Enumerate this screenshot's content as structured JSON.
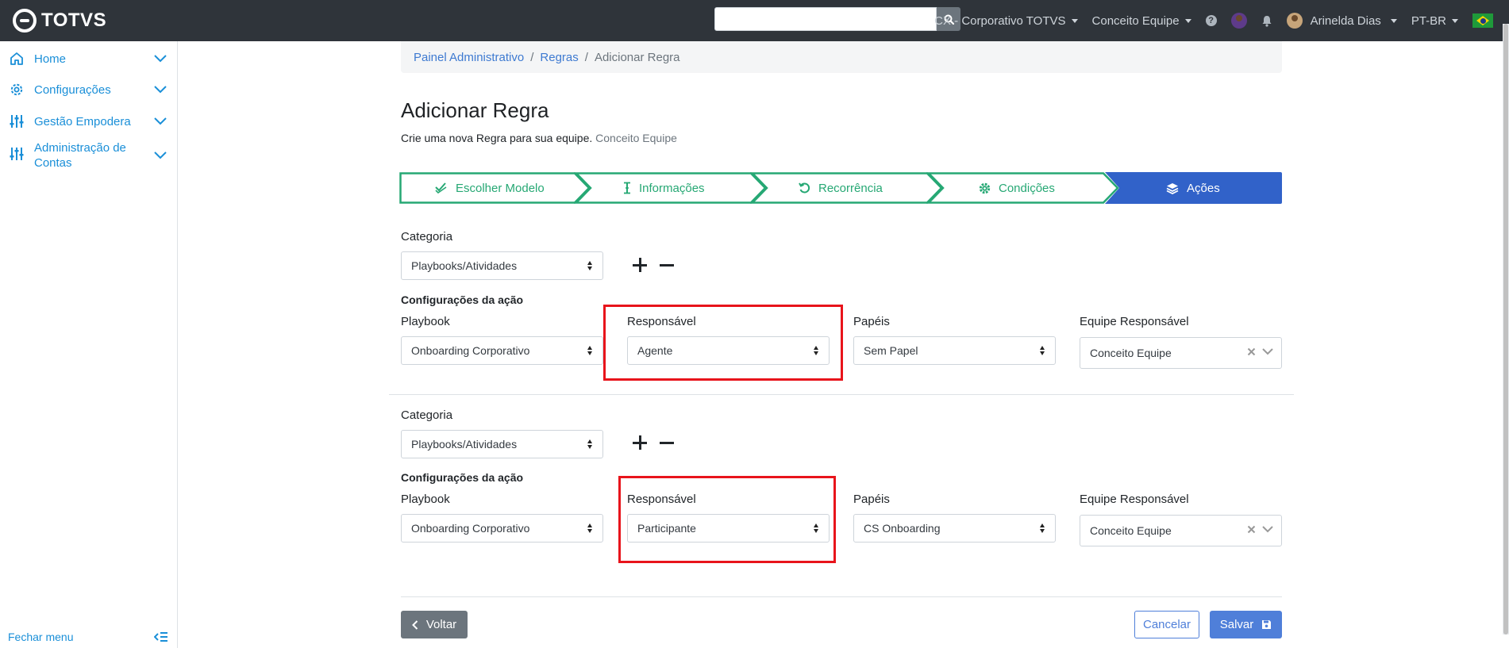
{
  "header": {
    "logo_text": "TOTVS",
    "search": {
      "value": "",
      "placeholder": ""
    },
    "org_menu": "CX - Corporativo TOTVS",
    "team_menu": "Conceito Equipe",
    "help_glyph": "?",
    "user_name": "Arinelda Dias",
    "language": "PT-BR"
  },
  "sidebar": {
    "items": [
      {
        "label": "Home",
        "icon": "home-icon"
      },
      {
        "label": "Configurações",
        "icon": "gear-icon"
      },
      {
        "label": "Gestão Empodera",
        "icon": "sliders-icon"
      },
      {
        "label_line1": "Administração de",
        "label_line2": "Contas",
        "icon": "sliders-icon"
      }
    ],
    "footer_label": "Fechar menu"
  },
  "breadcrumb": {
    "items": [
      "Painel Administrativo",
      "Regras"
    ],
    "current": "Adicionar Regra",
    "separator": "/"
  },
  "page": {
    "title": "Adicionar Regra",
    "subtitle": "Crie uma nova Regra para sua equipe.",
    "subtitle_team": "Conceito Equipe"
  },
  "wizard": {
    "steps": [
      {
        "label": "Escolher Modelo",
        "icon": "double-check-icon",
        "state": "done"
      },
      {
        "label": "Informações",
        "icon": "text-cursor-icon",
        "state": "done"
      },
      {
        "label": "Recorrência",
        "icon": "undo-icon",
        "state": "done"
      },
      {
        "label": "Condições",
        "icon": "gear-icon",
        "state": "done"
      },
      {
        "label": "Ações",
        "icon": "layers-icon",
        "state": "active"
      }
    ],
    "done_color": "#26a874",
    "active_color": "#3162c9"
  },
  "labels": {
    "category": "Categoria",
    "action_config": "Configurações da ação",
    "playbook": "Playbook",
    "responsible": "Responsável",
    "roles": "Papéis",
    "team_responsible": "Equipe Responsável"
  },
  "actions": [
    {
      "category": "Playbooks/Atividades",
      "playbook": "Onboarding Corporativo",
      "responsible": "Agente",
      "roles": "Sem Papel",
      "team": "Conceito Equipe"
    },
    {
      "category": "Playbooks/Atividades",
      "playbook": "Onboarding Corporativo",
      "responsible": "Participante",
      "roles": "CS Onboarding",
      "team": "Conceito Equipe"
    }
  ],
  "footer": {
    "back_label": "Voltar",
    "cancel_label": "Cancelar",
    "save_label": "Salvar"
  },
  "colors": {
    "topbar": "#2f343a",
    "link": "#1a8fd8",
    "primary": "#4f7fd9",
    "highlight": "#e8141b"
  }
}
